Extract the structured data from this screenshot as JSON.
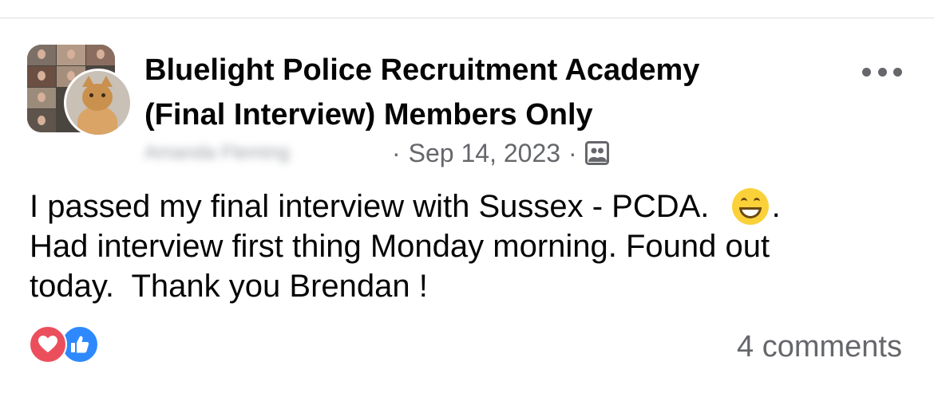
{
  "post": {
    "group_name_line1": "Bluelight Police Recruitment Academy",
    "group_name_line2": "(Final Interview) Members Only",
    "author": "Amanda Fleming",
    "separator": "·",
    "date": "Sep 14, 2023",
    "audience_icon": "group-audience-icon",
    "body": {
      "line1_before_emoji": "I passed my final interview with Sussex - PCDA.  ",
      "emoji": "grinning-face-emoji",
      "line1_after_emoji": ".",
      "line2": "Had interview first thing Monday morning. Found out",
      "line3": "today.  Thank you Brendan !"
    },
    "options_icon": "more-options-icon"
  },
  "footer": {
    "reactions": [
      "love-reaction-icon",
      "like-reaction-icon"
    ],
    "comments_label": "4 comments"
  },
  "colors": {
    "text_primary": "#050505",
    "text_secondary": "#65676b",
    "love": "#ec4f5c",
    "like": "#2e89ff"
  }
}
